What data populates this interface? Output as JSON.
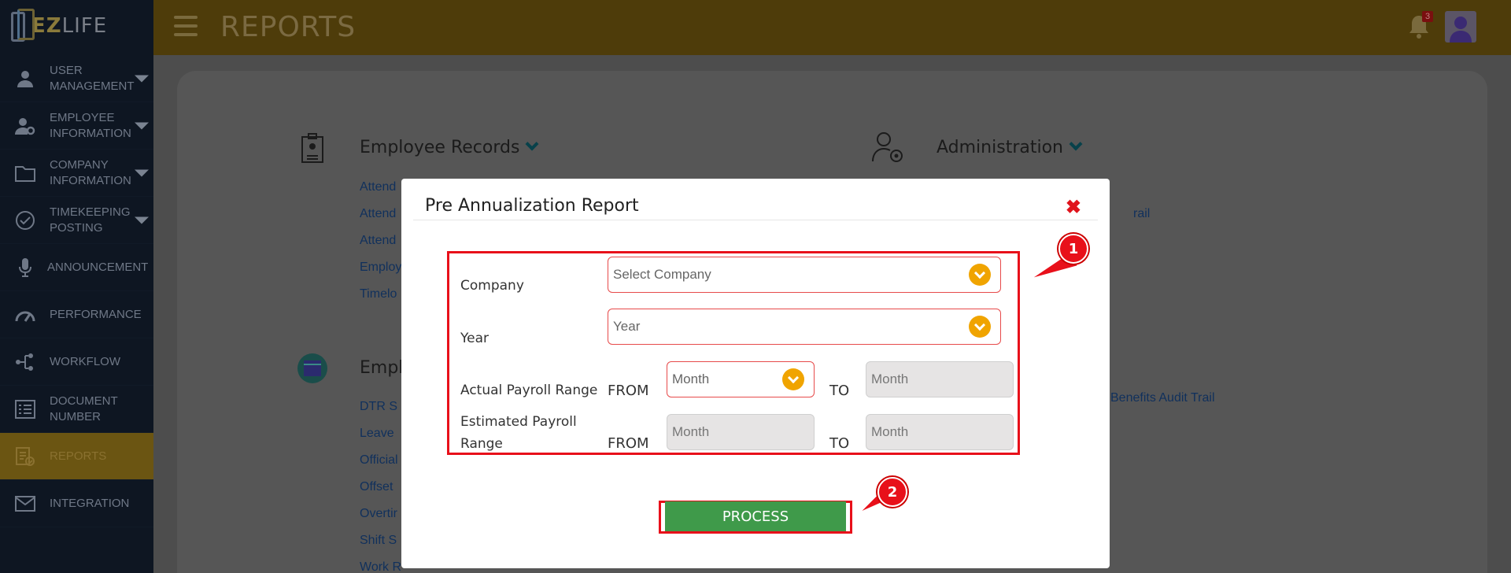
{
  "brand": {
    "logo_ez": "EZ",
    "logo_life": "LIFE"
  },
  "header": {
    "title": "REPORTS",
    "notification_count": "3"
  },
  "sidebar": {
    "items": [
      {
        "label": "USER MANAGEMENT",
        "icon": "user-icon",
        "has_caret": true
      },
      {
        "label": "EMPLOYEE INFORMATION",
        "icon": "user-gear-icon",
        "has_caret": true
      },
      {
        "label": "COMPANY INFORMATION",
        "icon": "folder-icon",
        "has_caret": true
      },
      {
        "label": "TIMEKEEPING POSTING",
        "icon": "check-circle-icon",
        "has_caret": true
      },
      {
        "label": "ANNOUNCEMENT",
        "icon": "microphone-icon",
        "has_caret": false
      },
      {
        "label": "PERFORMANCE",
        "icon": "gauge-icon",
        "has_caret": false
      },
      {
        "label": "WORKFLOW",
        "icon": "workflow-icon",
        "has_caret": false
      },
      {
        "label": "DOCUMENT NUMBER",
        "icon": "list-icon",
        "has_caret": false
      },
      {
        "label": "REPORTS",
        "icon": "report-icon",
        "has_caret": false,
        "active": true
      },
      {
        "label": "INTEGRATION",
        "icon": "mail-icon",
        "has_caret": false
      }
    ]
  },
  "background": {
    "employee_records_title": "Employee Records",
    "administration_title": "Administration",
    "employee_section_title": "Empl",
    "left_links": [
      "Attend",
      "Attend",
      "Attend",
      "Employ",
      "Timelo"
    ],
    "left_links_2": [
      "DTR S",
      "Leave",
      "Official",
      "Offset",
      "Overtir",
      "Shift S",
      "Work R"
    ],
    "right_links": [
      "rail",
      "Benefits Audit Trail"
    ]
  },
  "modal": {
    "title": "Pre Annualization Report",
    "company_label": "Company",
    "company_placeholder": "Select Company",
    "year_label": "Year",
    "year_placeholder": "Year",
    "actual_label": "Actual Payroll Range",
    "estimated_label_line1": "Estimated Payroll",
    "estimated_label_line2": "Range",
    "from_label": "FROM",
    "to_label": "TO",
    "month_placeholder": "Month",
    "process_label": "PROCESS"
  },
  "callouts": [
    "1",
    "2"
  ],
  "colors": {
    "accent": "#f0a400",
    "highlight": "#e8101a",
    "process_green": "#3f9a4a"
  }
}
